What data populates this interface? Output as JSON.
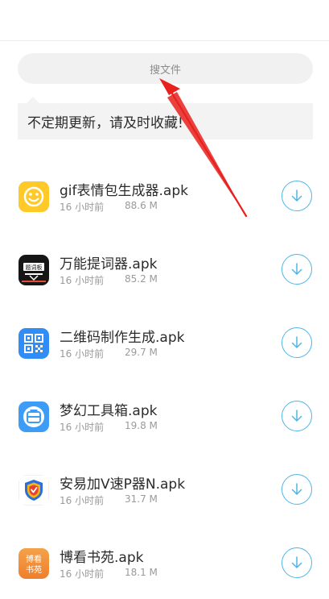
{
  "search": {
    "placeholder": "搜文件"
  },
  "notice": {
    "text": "不定期更新，请及时收藏!"
  },
  "colors": {
    "accent": "#4fb6e6",
    "annotation_arrow": "#e8211d"
  },
  "files": [
    {
      "name": "gif表情包生成器.apk",
      "time": "16 小时前",
      "size": "88.6 M",
      "icon": "smiley-face-icon"
    },
    {
      "name": "万能提词器.apk",
      "time": "16 小时前",
      "size": "85.2 M",
      "icon": "teleprompter-icon",
      "icon_text": "题词板"
    },
    {
      "name": "二维码制作生成.apk",
      "time": "16 小时前",
      "size": "29.7 M",
      "icon": "qr-code-icon"
    },
    {
      "name": "梦幻工具箱.apk",
      "time": "16 小时前",
      "size": "19.8 M",
      "icon": "toolbox-icon"
    },
    {
      "name": "安易加V速P器N.apk",
      "time": "16 小时前",
      "size": "31.7 M",
      "icon": "shield-icon"
    },
    {
      "name": "博看书苑.apk",
      "time": "16 小时前",
      "size": "18.1 M",
      "icon": "bookstore-icon",
      "icon_text": [
        "博看",
        "书苑"
      ]
    }
  ]
}
